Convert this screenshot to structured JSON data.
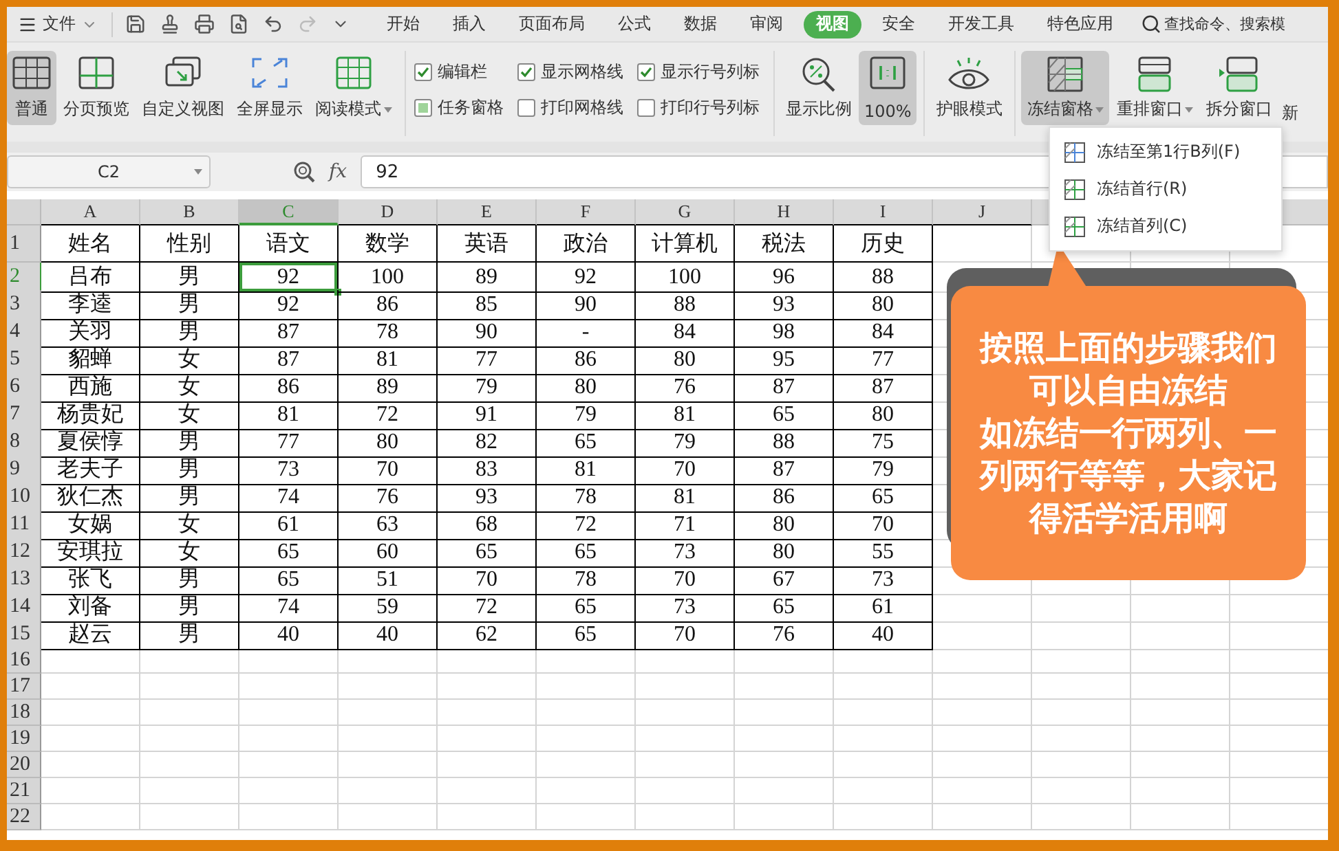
{
  "menu": {
    "file_label": "文件",
    "tabs": [
      {
        "label": "开始",
        "selected": false
      },
      {
        "label": "插入",
        "selected": false
      },
      {
        "label": "页面布局",
        "selected": false
      },
      {
        "label": "公式",
        "selected": false
      },
      {
        "label": "数据",
        "selected": false
      },
      {
        "label": "审阅",
        "selected": false
      },
      {
        "label": "视图",
        "selected": true
      },
      {
        "label": "安全",
        "selected": false
      },
      {
        "label": "开发工具",
        "selected": false
      },
      {
        "label": "特色应用",
        "selected": false
      }
    ],
    "search": {
      "placeholder": "查找命令、搜索模"
    }
  },
  "toolbar": {
    "view_group": [
      {
        "label": "普通",
        "selected": true,
        "dropdown": false
      },
      {
        "label": "分页预览",
        "selected": false,
        "dropdown": false
      },
      {
        "label": "自定义视图",
        "selected": false,
        "dropdown": false
      },
      {
        "label": "全屏显示",
        "selected": false,
        "dropdown": false
      },
      {
        "label": "阅读模式",
        "selected": false,
        "dropdown": true
      }
    ],
    "checkboxes": [
      {
        "label": "编辑栏",
        "kind": "tick",
        "checked": true
      },
      {
        "label": "任务窗格",
        "kind": "fill",
        "checked": true
      },
      {
        "label": "显示网格线",
        "kind": "tick",
        "checked": true
      },
      {
        "label": "打印网格线",
        "checked": false
      },
      {
        "label": "显示行号列标",
        "kind": "tick",
        "checked": true
      },
      {
        "label": "打印行号列标",
        "checked": false
      }
    ],
    "zoom_group": [
      {
        "label": "显示比例",
        "selected": false,
        "dropdown": false
      },
      {
        "label": "100%",
        "selected": true,
        "dropdown": false
      }
    ],
    "eye_group": [
      {
        "label": "护眼模式",
        "selected": false,
        "dropdown": false
      }
    ],
    "window_group": [
      {
        "label": "冻结窗格",
        "selected": true,
        "dropdown": true
      },
      {
        "label": "重排窗口",
        "selected": false,
        "dropdown": true
      },
      {
        "label": "拆分窗口",
        "selected": false,
        "dropdown": false
      }
    ],
    "cut_label": "新"
  },
  "formula_bar": {
    "name_box": "C2",
    "function_label": "fx",
    "formula": "92"
  },
  "sheet": {
    "columns": [
      {
        "label": "A",
        "selected": false
      },
      {
        "label": "B",
        "selected": false
      },
      {
        "label": "C",
        "selected": true
      },
      {
        "label": "D",
        "selected": false
      },
      {
        "label": "E",
        "selected": false
      },
      {
        "label": "F",
        "selected": false
      },
      {
        "label": "G",
        "selected": false
      },
      {
        "label": "H",
        "selected": false
      },
      {
        "label": "I",
        "selected": false
      },
      {
        "label": "J",
        "selected": false
      }
    ],
    "rows": [
      {
        "number": "1",
        "selected": false,
        "cells": [
          "姓名",
          "性别",
          "语文",
          "数学",
          "英语",
          "政治",
          "计算机",
          "税法",
          "历史"
        ]
      },
      {
        "number": "2",
        "selected": true,
        "cells": [
          "吕布",
          "男",
          "92",
          "100",
          "89",
          "92",
          "100",
          "96",
          "88"
        ]
      },
      {
        "number": "3",
        "selected": false,
        "cells": [
          "李逵",
          "男",
          "92",
          "86",
          "85",
          "90",
          "88",
          "93",
          "80"
        ]
      },
      {
        "number": "4",
        "selected": false,
        "cells": [
          "关羽",
          "男",
          "87",
          "78",
          "90",
          "-",
          "84",
          "98",
          "84"
        ]
      },
      {
        "number": "5",
        "selected": false,
        "cells": [
          "貂蝉",
          "女",
          "87",
          "81",
          "77",
          "86",
          "80",
          "95",
          "77"
        ]
      },
      {
        "number": "6",
        "selected": false,
        "cells": [
          "西施",
          "女",
          "86",
          "89",
          "79",
          "80",
          "76",
          "87",
          "87"
        ]
      },
      {
        "number": "7",
        "selected": false,
        "cells": [
          "杨贵妃",
          "女",
          "81",
          "72",
          "91",
          "79",
          "81",
          "65",
          "80"
        ]
      },
      {
        "number": "8",
        "selected": false,
        "cells": [
          "夏侯惇",
          "男",
          "77",
          "80",
          "82",
          "65",
          "79",
          "88",
          "75"
        ]
      },
      {
        "number": "9",
        "selected": false,
        "cells": [
          "老夫子",
          "男",
          "73",
          "70",
          "83",
          "81",
          "70",
          "87",
          "79"
        ]
      },
      {
        "number": "10",
        "selected": false,
        "cells": [
          "狄仁杰",
          "男",
          "74",
          "76",
          "93",
          "78",
          "81",
          "86",
          "65"
        ]
      },
      {
        "number": "11",
        "selected": false,
        "cells": [
          "女娲",
          "女",
          "61",
          "63",
          "68",
          "72",
          "71",
          "80",
          "70"
        ]
      },
      {
        "number": "12",
        "selected": false,
        "cells": [
          "安琪拉",
          "女",
          "65",
          "60",
          "65",
          "65",
          "73",
          "80",
          "55"
        ]
      },
      {
        "number": "13",
        "selected": false,
        "cells": [
          "张飞",
          "男",
          "65",
          "51",
          "70",
          "78",
          "70",
          "67",
          "73"
        ]
      },
      {
        "number": "14",
        "selected": false,
        "cells": [
          "刘备",
          "男",
          "74",
          "59",
          "72",
          "65",
          "73",
          "65",
          "61"
        ]
      },
      {
        "number": "15",
        "selected": false,
        "cells": [
          "赵云",
          "男",
          "40",
          "40",
          "62",
          "65",
          "70",
          "76",
          "40"
        ]
      },
      {
        "number": "16",
        "selected": false,
        "cells": []
      },
      {
        "number": "17",
        "selected": false,
        "cells": []
      },
      {
        "number": "18",
        "selected": false,
        "cells": []
      },
      {
        "number": "19",
        "selected": false,
        "cells": []
      },
      {
        "number": "20",
        "selected": false,
        "cells": []
      },
      {
        "number": "21",
        "selected": false,
        "cells": []
      },
      {
        "number": "22",
        "selected": false,
        "cells": []
      }
    ]
  },
  "dropdown_menu": {
    "items": [
      {
        "label": "冻结至第1行B列(F)"
      },
      {
        "label": "冻结首行(R)"
      },
      {
        "label": "冻结首列(C)"
      }
    ]
  },
  "callout": {
    "paragraphs": [
      "按照上面的步骤我们可以自由冻结",
      "如冻结一行两列、一列两行等等，大家记得活学活用啊"
    ]
  }
}
